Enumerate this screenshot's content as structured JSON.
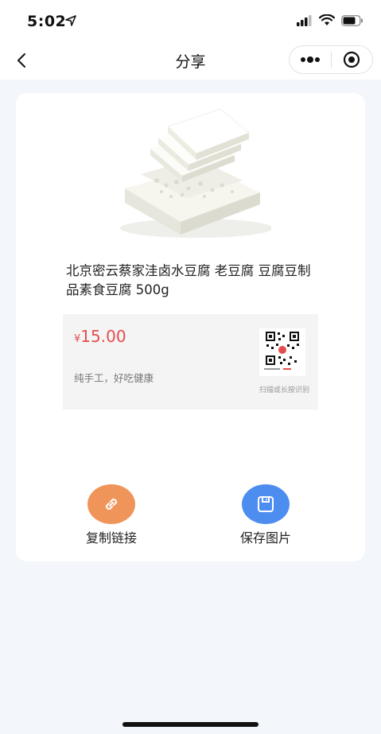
{
  "status_bar": {
    "time": "5:02"
  },
  "nav": {
    "title": "分享",
    "back_icon": "chevron-left-icon",
    "more_icon": "more-dots-icon",
    "close_icon": "target-close-icon"
  },
  "product": {
    "title": "北京密云蔡家洼卤水豆腐 老豆腐 豆腐豆制品素食豆腐 500g",
    "price_symbol": "¥",
    "price": "15.00",
    "description": "纯手工，好吃健康",
    "qr_hint": "扫描或长按识别"
  },
  "actions": {
    "copy_link": {
      "label": "复制链接",
      "icon": "link-icon",
      "color": "#f0955a"
    },
    "save_image": {
      "label": "保存图片",
      "icon": "save-icon",
      "color": "#4e8df0"
    }
  },
  "colors": {
    "price": "#e34d4d",
    "background": "#f3f6fa"
  }
}
